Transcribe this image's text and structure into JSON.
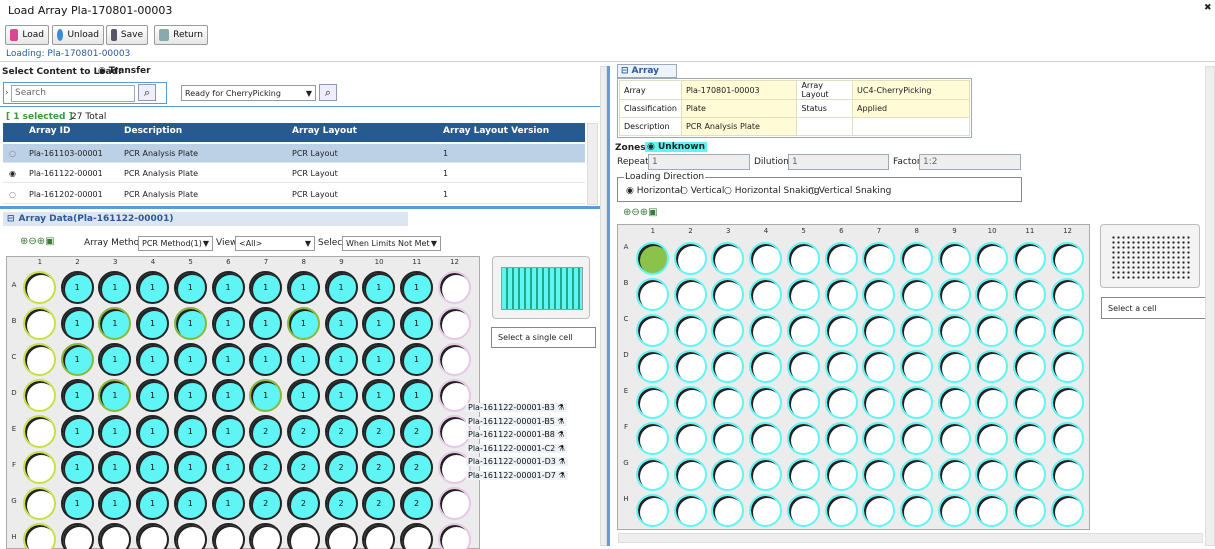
{
  "window": {
    "title": "Load Array Pla-170801-00003"
  },
  "toolbar": {
    "load": "Load",
    "unload": "Unload",
    "save": "Save",
    "return": "Return"
  },
  "loading_label": "Loading: Pla-170801-00003",
  "left": {
    "select_content_label": "Select Content to Load:",
    "transfer_label": "Transfer",
    "search_placeholder": "Search",
    "filter_select": "Ready for CherryPicking",
    "selected_count": "[ 1 selected ]",
    "total": "27 Total",
    "columns": [
      "Array ID",
      "Description",
      "Array Layout",
      "Array Layout Version"
    ],
    "rows": [
      {
        "id": "Pla-161103-00001",
        "desc": "PCR Analysis Plate",
        "layout": "PCR Layout",
        "version": "1"
      },
      {
        "id": "Pla-161122-00001",
        "desc": "PCR Analysis Plate",
        "layout": "PCR Layout",
        "version": "1"
      },
      {
        "id": "Pla-161202-00001",
        "desc": "PCR Analysis Plate",
        "layout": "PCR Layout",
        "version": "1"
      }
    ],
    "array_data_title": "Array Data(Pla-161122-00001)",
    "array_method_label": "Array Method",
    "array_method_value": "PCR Method(1)",
    "view_label": "View",
    "view_value": "<All>",
    "select_label": "Select",
    "select_value": "When Limits Not Met",
    "select_single_cell": "Select a single cell",
    "cols": [
      "1",
      "2",
      "3",
      "4",
      "5",
      "6",
      "7",
      "8",
      "9",
      "10",
      "11",
      "12"
    ],
    "rows_labels": [
      "A",
      "B",
      "C",
      "D",
      "E",
      "F",
      "G",
      "H"
    ],
    "well_values": [
      [
        "",
        "1",
        "1",
        "1",
        "1",
        "1",
        "1",
        "1",
        "1",
        "1",
        "1",
        ""
      ],
      [
        "",
        "1",
        "1",
        "1",
        "1",
        "1",
        "1",
        "1",
        "1",
        "1",
        "1",
        ""
      ],
      [
        "",
        "1",
        "1",
        "1",
        "1",
        "1",
        "1",
        "1",
        "1",
        "1",
        "1",
        ""
      ],
      [
        "",
        "1",
        "1",
        "1",
        "1",
        "1",
        "1",
        "1",
        "1",
        "1",
        "1",
        ""
      ],
      [
        "",
        "1",
        "1",
        "1",
        "1",
        "1",
        "2",
        "2",
        "2",
        "2",
        "2",
        ""
      ],
      [
        "",
        "1",
        "1",
        "1",
        "1",
        "1",
        "2",
        "2",
        "2",
        "2",
        "2",
        ""
      ],
      [
        "",
        "1",
        "1",
        "1",
        "1",
        "1",
        "2",
        "2",
        "2",
        "2",
        "2",
        ""
      ],
      [
        "",
        "",
        "",
        "",
        "",
        "",
        "",
        "",
        "",
        "",
        "",
        ""
      ]
    ],
    "tooltips": [
      "Pla-161122-00001-B3",
      "Pla-161122-00001-B5",
      "Pla-161122-00001-B8",
      "Pla-161122-00001-C2",
      "Pla-161122-00001-D3",
      "Pla-161122-00001-D7"
    ]
  },
  "right": {
    "array_tab": "Array",
    "fields": {
      "array_k": "Array",
      "array_v": "Pla-170801-00003",
      "layout_k": "Array Layout",
      "layout_v": "UC4-CherryPicking",
      "class_k": "Classification",
      "class_v": "Plate",
      "status_k": "Status",
      "status_v": "Applied",
      "desc_k": "Description",
      "desc_v": "PCR Analysis Plate"
    },
    "zones_label": "Zones :",
    "zones_value": "Unknown",
    "repeats_label": "Repeats",
    "repeats_value": "1",
    "dilutions_label": "Dilutions",
    "dilutions_value": "1",
    "factor_label": "Factor",
    "factor_value": "1:2",
    "loading_direction": "Loading Direction",
    "directions": [
      "Horizontal",
      "Vertical",
      "Horizontal Snaking",
      "Vertical Snaking"
    ],
    "select_cell": "Select a cell"
  },
  "colors": {
    "accent": "#275b8f",
    "well": "#5ff5f5",
    "green": "#8bc34a"
  }
}
